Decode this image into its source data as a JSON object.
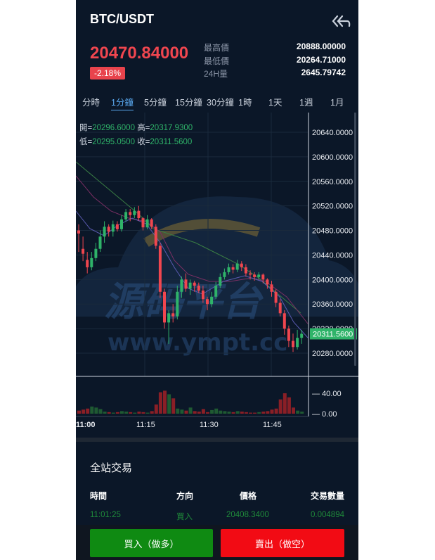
{
  "header": {
    "pair": "BTC/USDT",
    "back_icon": "double-chevron-left-icon"
  },
  "ticker": {
    "last_price": "20470.84000",
    "change_percent": "-2.18%",
    "stats": [
      {
        "label": "最高價",
        "value": "20888.00000"
      },
      {
        "label": "最低價",
        "value": "20264.71000"
      },
      {
        "label": "24H量",
        "value": "2645.79742"
      }
    ]
  },
  "periods": [
    "分時",
    "1分鐘",
    "5分鐘",
    "15分鐘",
    "30分鐘",
    "1時",
    "1天",
    "1週",
    "1月"
  ],
  "active_period": "1分鐘",
  "chart": {
    "ohlc": {
      "open_label": "開=",
      "open": "20296.6000",
      "high_label": "高=",
      "high": "20317.9300",
      "low_label": "低=",
      "low": "20295.0500",
      "close_label": "收=",
      "close": "20311.5600"
    },
    "price_ticks": [
      "20640.0000",
      "20600.0000",
      "20560.0000",
      "20520.0000",
      "20480.0000",
      "20440.0000",
      "20400.0000",
      "20360.0000",
      "20320.0000",
      "20280.0000"
    ],
    "current_price_tag": "20311.5600",
    "volume_ticks": [
      "40.00",
      "0.00"
    ],
    "time_ticks": [
      "11:00",
      "11:15",
      "11:30",
      "11:45"
    ],
    "watermark": {
      "logo_text": "源码平台",
      "url_text": "www.ympt.cc"
    },
    "colors": {
      "up": "#2fb369",
      "down": "#f0464f",
      "grid": "#1a2a3c"
    }
  },
  "trades": {
    "title": "全站交易",
    "columns": [
      "時間",
      "方向",
      "價格",
      "交易數量"
    ],
    "rows": [
      {
        "time": "11:01:25",
        "side": "買入",
        "price": "20408.3400",
        "amount": "0.004894"
      }
    ]
  },
  "actions": {
    "buy": "買入（做多）",
    "sell": "賣出（做空）"
  },
  "chart_data": {
    "type": "candlestick",
    "interval": "1分鐘",
    "x_ticks": [
      "11:00",
      "11:15",
      "11:30",
      "11:45"
    ],
    "y_ticks": [
      20640,
      20600,
      20560,
      20520,
      20480,
      20440,
      20400,
      20360,
      20320,
      20280
    ],
    "volume_ticks": [
      40,
      0
    ],
    "candles": [
      [
        20480,
        20475,
        20490,
        20445
      ],
      [
        20450,
        20442,
        20470,
        20430
      ],
      [
        20432,
        20420,
        20445,
        20410
      ],
      [
        20420,
        20435,
        20445,
        20415
      ],
      [
        20435,
        20450,
        20460,
        20430
      ],
      [
        20450,
        20470,
        20480,
        20445
      ],
      [
        20470,
        20486,
        20495,
        20460
      ],
      [
        20486,
        20478,
        20490,
        20470
      ],
      [
        20478,
        20490,
        20496,
        20470
      ],
      [
        20490,
        20482,
        20495,
        20478
      ],
      [
        20482,
        20498,
        20505,
        20478
      ],
      [
        20498,
        20510,
        20515,
        20494
      ],
      [
        20510,
        20505,
        20515,
        20495
      ],
      [
        20505,
        20512,
        20518,
        20500
      ],
      [
        20512,
        20500,
        20520,
        20496
      ],
      [
        20500,
        20485,
        20502,
        20480
      ],
      [
        20485,
        20498,
        20505,
        20482
      ],
      [
        20498,
        20486,
        20500,
        20482
      ],
      [
        20486,
        20455,
        20490,
        20450
      ],
      [
        20455,
        20380,
        20460,
        20370
      ],
      [
        20380,
        20330,
        20385,
        20320
      ],
      [
        20330,
        20345,
        20350,
        20295
      ],
      [
        20345,
        20340,
        20360,
        20330
      ],
      [
        20340,
        20380,
        20390,
        20335
      ],
      [
        20380,
        20400,
        20405,
        20370
      ],
      [
        20400,
        20385,
        20410,
        20380
      ],
      [
        20385,
        20395,
        20400,
        20375
      ],
      [
        20395,
        20390,
        20398,
        20380
      ],
      [
        20390,
        20382,
        20395,
        20378
      ],
      [
        20382,
        20368,
        20390,
        20362
      ],
      [
        20368,
        20360,
        20372,
        20350
      ],
      [
        20360,
        20372,
        20380,
        20355
      ],
      [
        20372,
        20390,
        20396,
        20368
      ],
      [
        20390,
        20404,
        20410,
        20386
      ],
      [
        20404,
        20412,
        20418,
        20400
      ],
      [
        20412,
        20420,
        20426,
        20408
      ],
      [
        20420,
        20416,
        20425,
        20410
      ],
      [
        20416,
        20426,
        20432,
        20412
      ],
      [
        20426,
        20420,
        20430,
        20414
      ],
      [
        20420,
        20410,
        20425,
        20405
      ],
      [
        20410,
        20408,
        20415,
        20400
      ],
      [
        20408,
        20404,
        20412,
        20398
      ],
      [
        20404,
        20408,
        20412,
        20400
      ],
      [
        20408,
        20400,
        20410,
        20394
      ],
      [
        20400,
        20392,
        20402,
        20385
      ],
      [
        20392,
        20380,
        20398,
        20372
      ],
      [
        20380,
        20362,
        20384,
        20355
      ],
      [
        20362,
        20345,
        20368,
        20340
      ],
      [
        20345,
        20320,
        20350,
        20310
      ],
      [
        20320,
        20300,
        20325,
        20290
      ],
      [
        20300,
        20290,
        20312,
        20282
      ],
      [
        20290,
        20305,
        20318,
        20286
      ],
      [
        20305,
        20311.56,
        20317.93,
        20295.05
      ]
    ],
    "volumes": [
      6,
      8,
      10,
      14,
      12,
      9,
      4,
      3,
      2,
      3,
      5,
      4,
      3,
      2,
      4,
      3,
      2,
      5,
      18,
      42,
      45,
      38,
      30,
      10,
      8,
      6,
      12,
      5,
      4,
      9,
      3,
      7,
      10,
      6,
      5,
      4,
      3,
      5,
      4,
      3,
      2,
      2,
      3,
      4,
      5,
      8,
      10,
      28,
      40,
      32,
      12,
      6,
      4
    ]
  }
}
